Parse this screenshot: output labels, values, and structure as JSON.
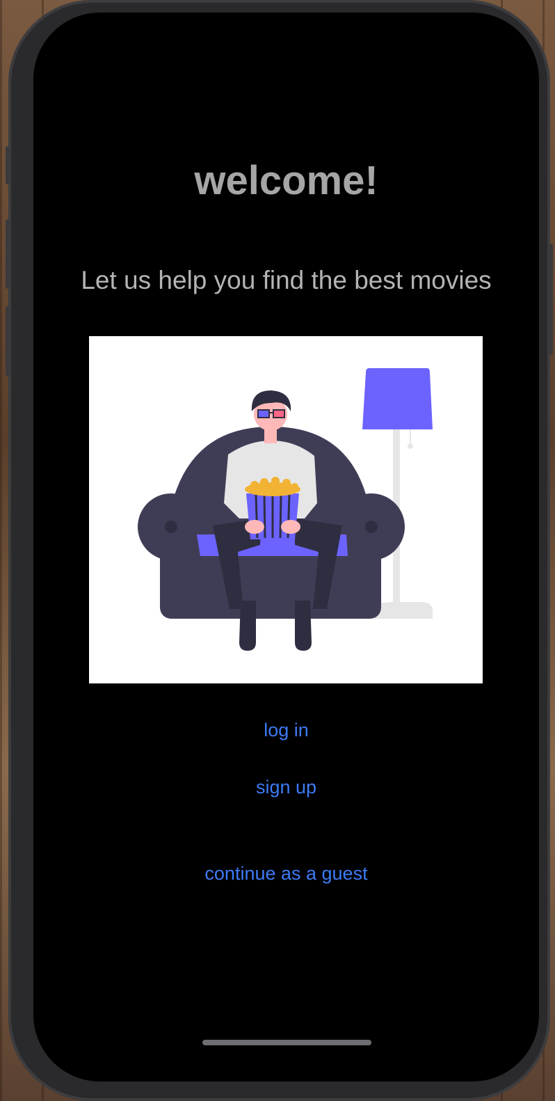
{
  "welcome": {
    "title": "welcome!",
    "subtitle": "Let us help you find the best movies"
  },
  "illustration": {
    "icon": "person-on-couch-with-popcorn-illustration",
    "accent": "#6c63ff",
    "couch_color": "#3f3d56"
  },
  "actions": {
    "login_label": "log in",
    "signup_label": "sign up",
    "guest_label": "continue as a guest",
    "link_color": "#3d7bf5"
  }
}
